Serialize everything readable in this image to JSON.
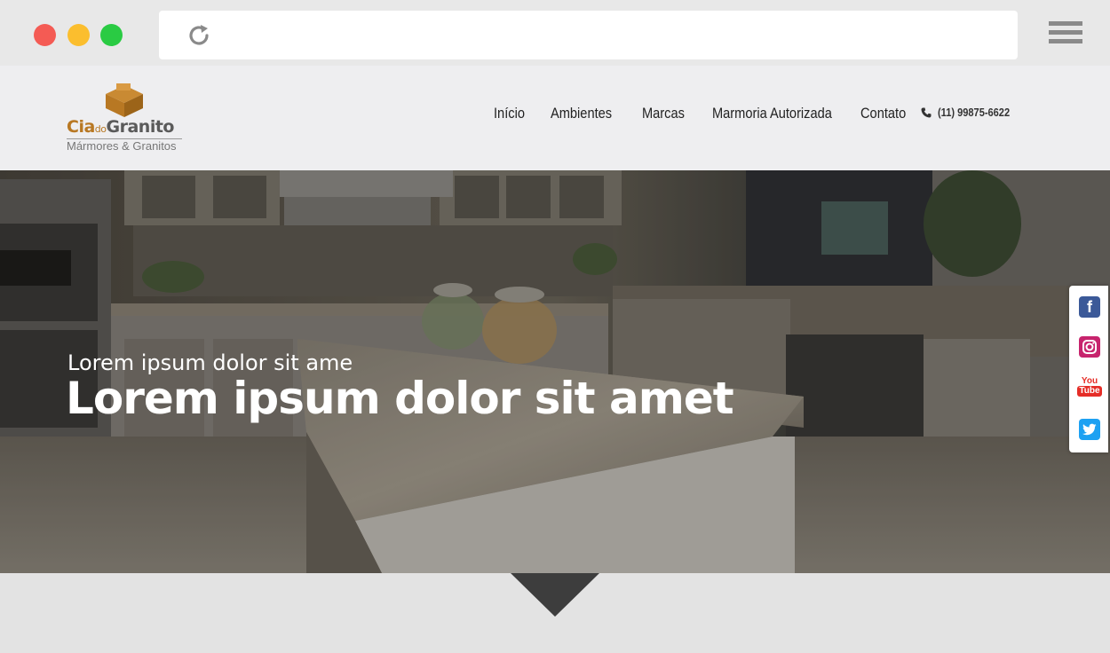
{
  "browser": {
    "controls": [
      "close-dot",
      "minimize-dot",
      "maximize-dot"
    ],
    "reload_icon": "reload-icon",
    "menu_icon": "hamburger-menu-icon"
  },
  "header": {
    "logo": {
      "name_part1": "Cia",
      "name_part2": "do",
      "name_part3": "Granito",
      "tagline": "Mármores & Granitos",
      "icon": "cube-logo-icon"
    },
    "nav": [
      {
        "label": "Início"
      },
      {
        "label": "Ambientes"
      },
      {
        "label": "Marcas"
      },
      {
        "label": "Marmoria Autorizada"
      },
      {
        "label": "Contato"
      }
    ],
    "phone": {
      "icon": "phone-icon",
      "number": "(11) 99875-6622"
    }
  },
  "hero": {
    "subtitle": "Lorem ipsum dolor sit ame",
    "title": "Lorem ipsum dolor sit amet"
  },
  "social": [
    {
      "name": "facebook-icon",
      "glyph": "f"
    },
    {
      "name": "instagram-icon"
    },
    {
      "name": "youtube-icon",
      "text1": "You",
      "text2": "Tube"
    },
    {
      "name": "twitter-icon"
    }
  ],
  "colors": {
    "accent_brown": "#b87823",
    "arrow": "#3d3d3d",
    "facebook": "#3b5998",
    "instagram": "#c7246d",
    "youtube": "#e52d27",
    "twitter": "#1da1f2"
  }
}
